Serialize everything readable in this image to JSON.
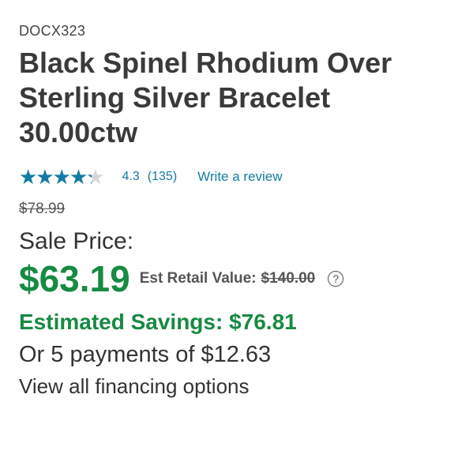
{
  "product": {
    "sku": "DOCX323",
    "title_lines": [
      "Black Spinel Rhodium Over",
      "Sterling Silver Bracelet",
      "30.00ctw"
    ]
  },
  "rating": {
    "stars_glyphs": "★★★★★",
    "value_number": 4.3,
    "value_text": "4.3",
    "count_text": "(135)",
    "write_review_label": "Write a review"
  },
  "pricing": {
    "original_price": "$78.99",
    "sale_label": "Sale Price:",
    "sale_price": "$63.19",
    "est_retail_label": "Est Retail Value:",
    "est_retail_value": "$140.00",
    "help_icon": "question-circle-icon",
    "help_glyph": "?",
    "savings_text": "Estimated Savings: $76.81",
    "payments_text": "Or 5 payments of $12.63",
    "financing_link": "View all financing options"
  },
  "colors": {
    "accent_blue": "#137ca3",
    "sale_green": "#178a43",
    "text_dark": "#333333"
  }
}
